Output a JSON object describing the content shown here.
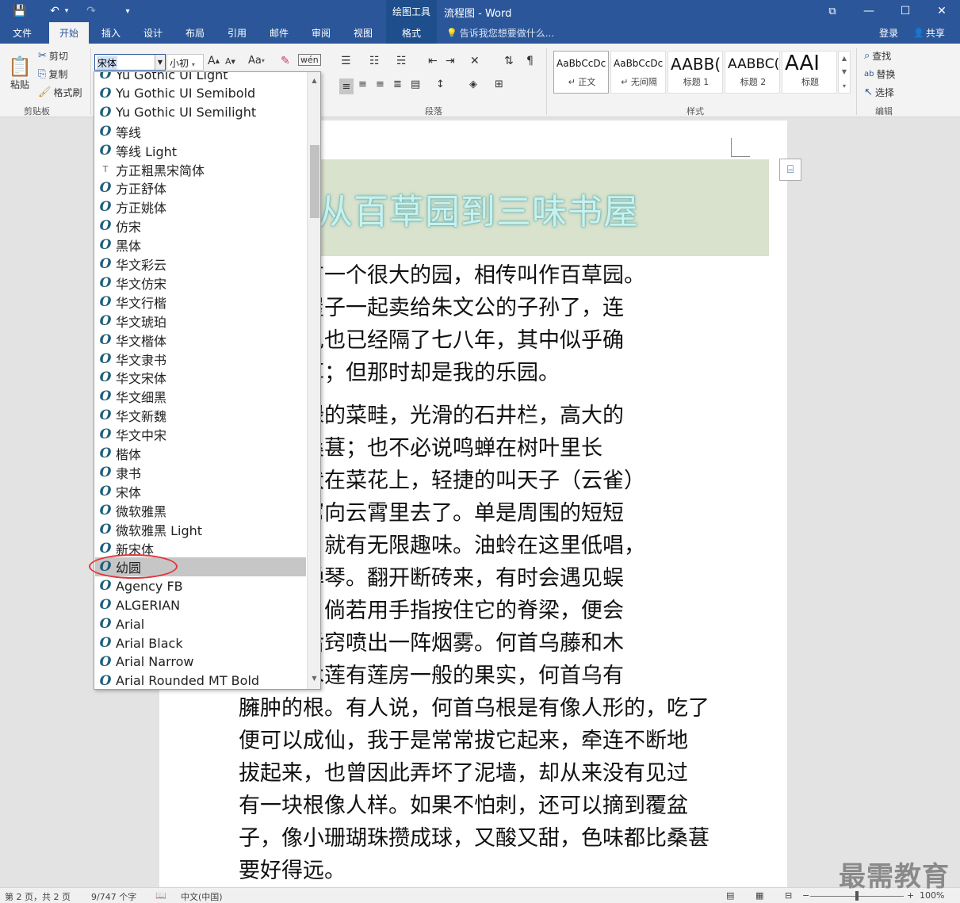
{
  "window": {
    "contextual_group": "绘图工具",
    "doc_title": "流程图 - Word"
  },
  "quick_access": {
    "save": "💾",
    "undo": "↶",
    "undo_dd": "▾",
    "redo": "↷",
    "customize": "▾"
  },
  "window_controls": {
    "ribbon_display": "⧉",
    "minimize": "—",
    "maximize": "☐",
    "close": "✕"
  },
  "tabs": [
    {
      "label": "文件"
    },
    {
      "label": "开始"
    },
    {
      "label": "插入"
    },
    {
      "label": "设计"
    },
    {
      "label": "布局"
    },
    {
      "label": "引用"
    },
    {
      "label": "邮件"
    },
    {
      "label": "审阅"
    },
    {
      "label": "视图"
    },
    {
      "label": "格式"
    }
  ],
  "tell_me": {
    "icon": "💡",
    "text": "告诉我您想要做什么..."
  },
  "account": {
    "signin": "登录",
    "share": "共享",
    "share_icon": "👤"
  },
  "clipboard": {
    "paste": "粘贴",
    "cut": "剪切",
    "copy": "复制",
    "format_painter": "格式刷",
    "label": "剪贴板"
  },
  "font": {
    "current": "宋体",
    "size": "小初",
    "grow": "A",
    "shrink": "A",
    "case": "Aa"
  },
  "paragraph": {
    "label": "段落"
  },
  "styles": {
    "label": "样式",
    "items": [
      {
        "sample": "AaBbCcDc",
        "name": "↵ 正文"
      },
      {
        "sample": "AaBbCcDc",
        "name": "↵ 无间隔"
      },
      {
        "sample": "AABB(",
        "name": "标题 1"
      },
      {
        "sample": "AABBC(",
        "name": "标题 2"
      },
      {
        "sample": "AAI",
        "name": "标题"
      }
    ]
  },
  "editing": {
    "find": "查找",
    "replace": "替换",
    "select": "选择",
    "label": "编辑"
  },
  "font_list": [
    {
      "name": "Yu Gothic UI Light",
      "type": "O"
    },
    {
      "name": "Yu Gothic UI Semibold",
      "type": "O"
    },
    {
      "name": "Yu Gothic UI Semilight",
      "type": "O"
    },
    {
      "name": "等线",
      "type": "O"
    },
    {
      "name": "等线 Light",
      "type": "O"
    },
    {
      "name": "方正粗黑宋简体",
      "type": "T"
    },
    {
      "name": "方正舒体",
      "type": "O"
    },
    {
      "name": "方正姚体",
      "type": "O"
    },
    {
      "name": "仿宋",
      "type": "O"
    },
    {
      "name": "黑体",
      "type": "O"
    },
    {
      "name": "华文彩云",
      "type": "O"
    },
    {
      "name": "华文仿宋",
      "type": "O"
    },
    {
      "name": "华文行楷",
      "type": "O"
    },
    {
      "name": "华文琥珀",
      "type": "O"
    },
    {
      "name": "华文楷体",
      "type": "O"
    },
    {
      "name": "华文隶书",
      "type": "O"
    },
    {
      "name": "华文宋体",
      "type": "O"
    },
    {
      "name": "华文细黑",
      "type": "O"
    },
    {
      "name": "华文新魏",
      "type": "O"
    },
    {
      "name": "华文中宋",
      "type": "O"
    },
    {
      "name": "楷体",
      "type": "O"
    },
    {
      "name": "隶书",
      "type": "O"
    },
    {
      "name": "宋体",
      "type": "O"
    },
    {
      "name": "微软雅黑",
      "type": "O"
    },
    {
      "name": "微软雅黑 Light",
      "type": "O"
    },
    {
      "name": "新宋体",
      "type": "O"
    },
    {
      "name": "幼圆",
      "type": "O",
      "highlighted": true
    },
    {
      "name": "Agency FB",
      "type": "O"
    },
    {
      "name": "ALGERIAN",
      "type": "O"
    },
    {
      "name": "Arial",
      "type": "O"
    },
    {
      "name": "Arial Black",
      "type": "O"
    },
    {
      "name": "Arial Narrow",
      "type": "O"
    },
    {
      "name": "Arial Rounded MT Bold",
      "type": "O"
    }
  ],
  "document": {
    "title": "从百草园到三味书屋",
    "lines": [
      "的后面有一个很大的园，相传叫作百草园。",
      "早已并屋子一起卖给朱文公的子孙了，连",
      "次的相见也已经隔了七八年，其中似乎确",
      "一些野草；但那时却是我的乐园。",
      "必说碧绿的菜畦，光滑的石井栏，高大的",
      "紫红的桑葚；也不必说鸣蝉在树叶里长",
      "的黄蜂伏在菜花上，轻捷的叫天子（云雀）",
      "草间直窜向云霄里去了。单是周围的短短",
      "根一带，就有无限趣味。油蛉在这里低唱，",
      "在这里弹琴。翻开断砖来，有时会遇见蜈",
      "有斑蝥，倘若用手指按住它的脊梁，便会",
      "声，从后窍喷出一阵烟雾。何首乌藤和木",
      "络着，木莲有莲房一般的果实，何首乌有",
      "臃肿的根。有人说，何首乌根是有像人形的，吃了",
      "便可以成仙，我于是常常拔它起来，牵连不断地",
      "拔起来，也曾因此弄坏了泥墙，却从来没有见过",
      "有一块根像人样。如果不怕刺，还可以摘到覆盆",
      "子，像小珊瑚珠攒成球，又酸又甜，色味都比桑葚",
      "要好得远。"
    ]
  },
  "status": {
    "page": "第 2 页，共 2 页",
    "words": "9/747 个字",
    "lang": "中文(中国)",
    "zoom": "100%",
    "zoom_minus": "−",
    "zoom_plus": "+"
  },
  "watermark": "最需教育"
}
